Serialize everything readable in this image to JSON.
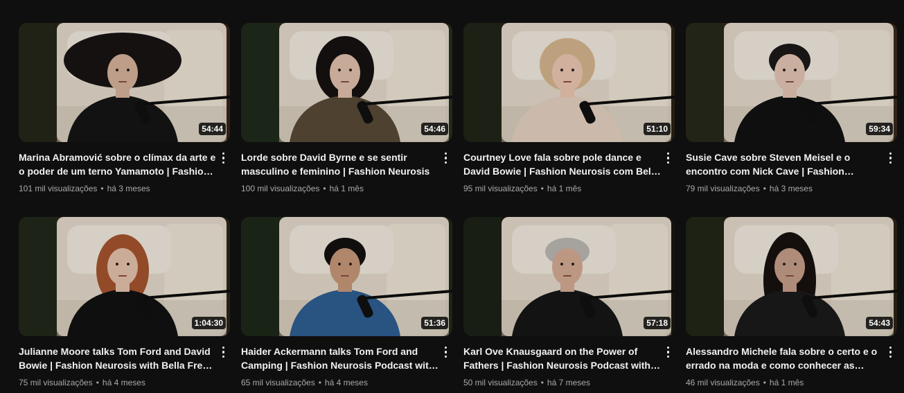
{
  "videos": [
    {
      "title": "Marina Abramović sobre o clímax da arte e o poder de um terno Yamamoto | Fashion Neurosis com Bella Freud",
      "duration": "54:44",
      "views": "101 mil visualizações",
      "age": "há 3 meses",
      "thumbnail": {
        "subject": "woman lying on cream sofa, long dark hair, black jacket",
        "skin": "#d9b49c",
        "hair": "#1a1414",
        "clothes": "#151515",
        "bg": "#3a2418",
        "hair_style": "spread"
      }
    },
    {
      "title": "Lorde sobre David Byrne e se sentir masculino e feminino | Fashion Neurosis",
      "duration": "54:46",
      "views": "100 mil visualizações",
      "age": "há 1 mês",
      "thumbnail": {
        "subject": "young woman with curly dark hair, olive jacket, microphone",
        "skin": "#e3c2ad",
        "hair": "#161212",
        "clothes": "#5b4a36",
        "bg": "#23301f",
        "hair_style": "curly"
      }
    },
    {
      "title": "Courtney Love fala sobre pole dance e David Bowie | Fashion Neurosis com Bella Freud",
      "duration": "51:10",
      "views": "95 mil visualizações",
      "age": "há 1 mês",
      "thumbnail": {
        "subject": "blonde woman with arms crossed on chest, microphone",
        "skin": "#f0c9b4",
        "hair": "#d8b890",
        "clothes": "#e8d4c4",
        "bg": "#2b2114",
        "hair_style": "blonde"
      }
    },
    {
      "title": "Susie Cave sobre Steven Meisel e o encontro com Nick Cave | Fashion Neurosis com Bella Freud",
      "duration": "59:34",
      "views": "79 mil visualizações",
      "age": "há 3 meses",
      "thumbnail": {
        "subject": "woman with dark hair in black embroidered kaftan",
        "skin": "#e6c8b8",
        "hair": "#1c1818",
        "clothes": "#121212",
        "bg": "#3b2a1d",
        "hair_style": "short"
      }
    },
    {
      "title": "Julianne Moore talks Tom Ford and David Bowie | Fashion Neurosis with Bella Freud | Podcast",
      "duration": "1:04:30",
      "views": "75 mil visualizações",
      "age": "há 4 meses",
      "thumbnail": {
        "subject": "red-haired woman in black shirt with microphone",
        "skin": "#e8c4ad",
        "hair": "#a8552e",
        "clothes": "#121212",
        "bg": "#2c2618",
        "hair_style": "red"
      }
    },
    {
      "title": "Haider Ackermann talks Tom Ford and Camping | Fashion Neurosis Podcast with Bella Freud",
      "duration": "51:36",
      "views": "65 mil visualizações",
      "age": "há 4 meses",
      "thumbnail": {
        "subject": "man with mustache in blue denim jacket",
        "skin": "#c99a7a",
        "hair": "#141010",
        "clothes": "#2f5f93",
        "bg": "#1f2b1a",
        "hair_style": "short"
      }
    },
    {
      "title": "Karl Ove Knausgaard on the Power of Fathers | Fashion Neurosis Podcast with Bella Freud",
      "duration": "57:18",
      "views": "50 mil visualizações",
      "age": "há 7 meses",
      "thumbnail": {
        "subject": "grey-haired man in black sweater",
        "skin": "#d6ad96",
        "hair": "#bdbab4",
        "clothes": "#161616",
        "bg": "#1c1611",
        "hair_style": "grey"
      }
    },
    {
      "title": "Alessandro Michele fala sobre o certo e o errado na moda e como conhecer as pessoas",
      "duration": "54:43",
      "views": "46 mil visualizações",
      "age": "há 1 mês",
      "thumbnail": {
        "subject": "man with long dark hair and beard holding microphone",
        "skin": "#c8a08a",
        "hair": "#17120f",
        "clothes": "#1b1b1b",
        "bg": "#2e2416",
        "hair_style": "long"
      }
    }
  ],
  "icons": {
    "menu": "more-vert-icon"
  }
}
